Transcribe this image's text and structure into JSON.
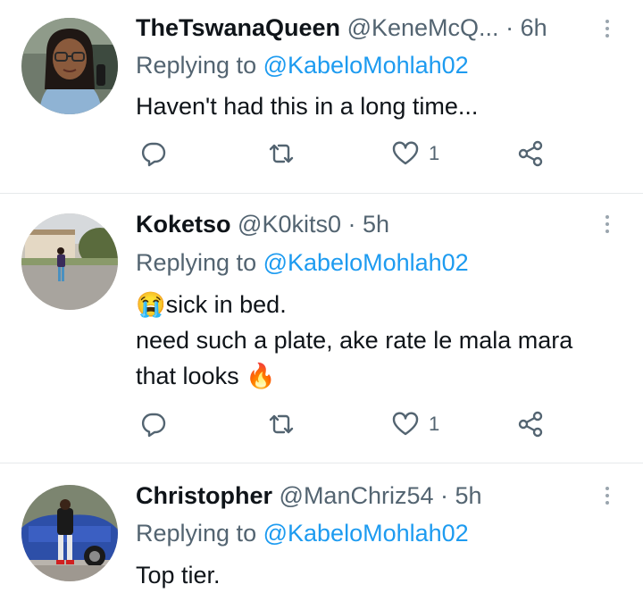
{
  "tweets": [
    {
      "name": "TheTswanaQueen",
      "handle": "@KeneMcQ...",
      "dot": "·",
      "time": "6h",
      "replying_prefix": "Replying to",
      "replying_to": "@KabeloMohlah02",
      "lines": [
        "Haven't had this in a long time..."
      ],
      "like_count": "1"
    },
    {
      "name": "Koketso",
      "handle": "@K0kits0",
      "dot": "·",
      "time": "5h",
      "replying_prefix": "Replying to",
      "replying_to": "@KabeloMohlah02",
      "emoji_cry": "😭",
      "lines": [
        "sick in bed.",
        "need such a plate, ake rate le mala mara",
        "that looks"
      ],
      "emoji_fire": "🔥",
      "like_count": "1"
    },
    {
      "name": "Christopher",
      "handle": "@ManChriz54",
      "dot": "·",
      "time": "5h",
      "replying_prefix": "Replying to",
      "replying_to": "@KabeloMohlah02",
      "lines": [
        "Top tier."
      ]
    }
  ],
  "icons": {
    "reply": "reply-icon",
    "retweet": "retweet-icon",
    "like": "heart-icon",
    "share": "share-icon",
    "more": "more-vertical-icon"
  },
  "colors": {
    "link": "#1d9bf0",
    "secondary_text": "#536471",
    "primary_text": "#0f1419",
    "divider": "#e6e9eb"
  }
}
